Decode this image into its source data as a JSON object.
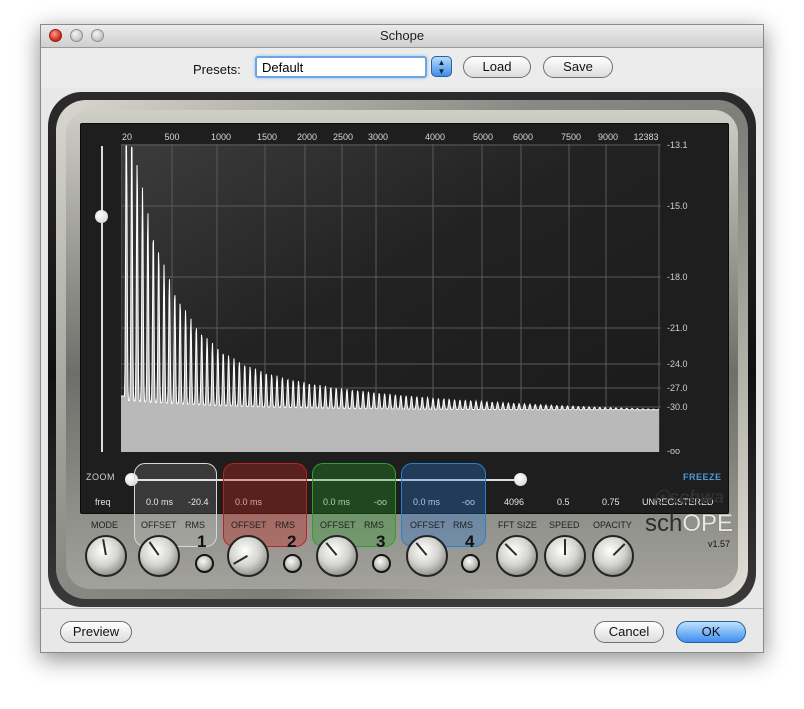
{
  "window": {
    "title": "Schope"
  },
  "toolbar": {
    "presets_label": "Presets:",
    "preset_value": "Default",
    "load_label": "Load",
    "save_label": "Save"
  },
  "display": {
    "freq_labels": [
      "20",
      "500",
      "1000",
      "1500",
      "2000",
      "2500",
      "3000",
      "4000",
      "5000",
      "6000",
      "7500",
      "9000",
      "12383"
    ],
    "db_labels": [
      "-13.1",
      "-15.0",
      "-18.0",
      "-21.0",
      "-24.0",
      "-27.0",
      "-30.0",
      "-oo"
    ],
    "zoom_label": "ZOOM",
    "freeze_label": "FREEZE",
    "registration": "UNREGISTERED"
  },
  "info_row": {
    "freq": "freq",
    "ch1": {
      "offset": "0.0 ms",
      "rms": "-20.4"
    },
    "ch2": {
      "offset": "0.0 ms",
      "rms": ""
    },
    "ch3": {
      "offset": "0.0 ms",
      "rms": "-oo"
    },
    "ch4": {
      "offset": "0.0 ms",
      "rms": "-oo"
    },
    "fft_size": "4096",
    "speed": "0.5",
    "opacity": "0.75"
  },
  "controls": {
    "mode": "MODE",
    "offset": "OFFSET",
    "rms": "RMS",
    "fft_size": "FFT SIZE",
    "speed": "SPEED",
    "opacity": "OPACITY",
    "channels": [
      "1",
      "2",
      "3",
      "4"
    ]
  },
  "channel_colors": {
    "ch1": "#d8d8d8",
    "ch2": "#c0211e",
    "ch3": "#2ea02e",
    "ch4": "#2a7fd0"
  },
  "logo": {
    "brand": "schwa",
    "product_a": "sch",
    "product_b": "OPE",
    "version": "v1.57"
  },
  "footer": {
    "preview_label": "Preview",
    "cancel_label": "Cancel",
    "ok_label": "OK"
  },
  "spectrum": {
    "peak_db": -13.1,
    "floor_db": -30.0,
    "peaks": 100
  }
}
